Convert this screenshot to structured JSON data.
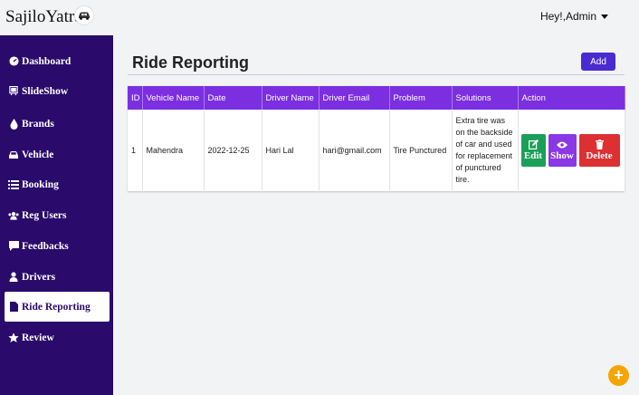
{
  "app": {
    "brand": "SajiloYatra",
    "user_menu_label": "Hey!,Admin"
  },
  "sidebar": {
    "items": [
      {
        "label": "Dashboard",
        "icon": "dashboard-icon"
      },
      {
        "label": "SlideShow",
        "icon": "slideshow-icon"
      },
      {
        "label": "Brands",
        "icon": "droplet-icon"
      },
      {
        "label": "Vehicle",
        "icon": "car-icon"
      },
      {
        "label": "Booking",
        "icon": "list-icon"
      },
      {
        "label": "Reg Users",
        "icon": "users-icon"
      },
      {
        "label": "Feedbacks",
        "icon": "comment-icon"
      },
      {
        "label": "Drivers",
        "icon": "user-icon"
      },
      {
        "label": "Ride Reporting",
        "icon": "file-icon",
        "active": true
      },
      {
        "label": "Review",
        "icon": "star-icon"
      }
    ]
  },
  "main": {
    "title": "Ride Reporting",
    "add_label": "Add",
    "table": {
      "headers": [
        "ID",
        "Vehicle Name",
        "Date",
        "Driver Name",
        "Driver Email",
        "Problem",
        "Solutions",
        "Action"
      ],
      "rows": [
        {
          "id": "1",
          "vehicle": "Mahendra",
          "date": "2022-12-25",
          "driver": "Hari Lal",
          "email": "hari@gmail.com",
          "problem": "Tire Punctured",
          "solution": "Extra tire was on the backside of car and used for replacement of punctured tire."
        }
      ],
      "actions": {
        "edit": "Edit",
        "show": "Show",
        "delete": "Delete"
      }
    }
  },
  "fab": {
    "label": "+"
  },
  "colors": {
    "sidebar": "#2a0a6b",
    "table_header": "#7b2fe0",
    "add_button": "#4a2bd1",
    "edit": "#1aa058",
    "show": "#8a37e6",
    "delete": "#dc3033",
    "fab": "#f6a500"
  }
}
